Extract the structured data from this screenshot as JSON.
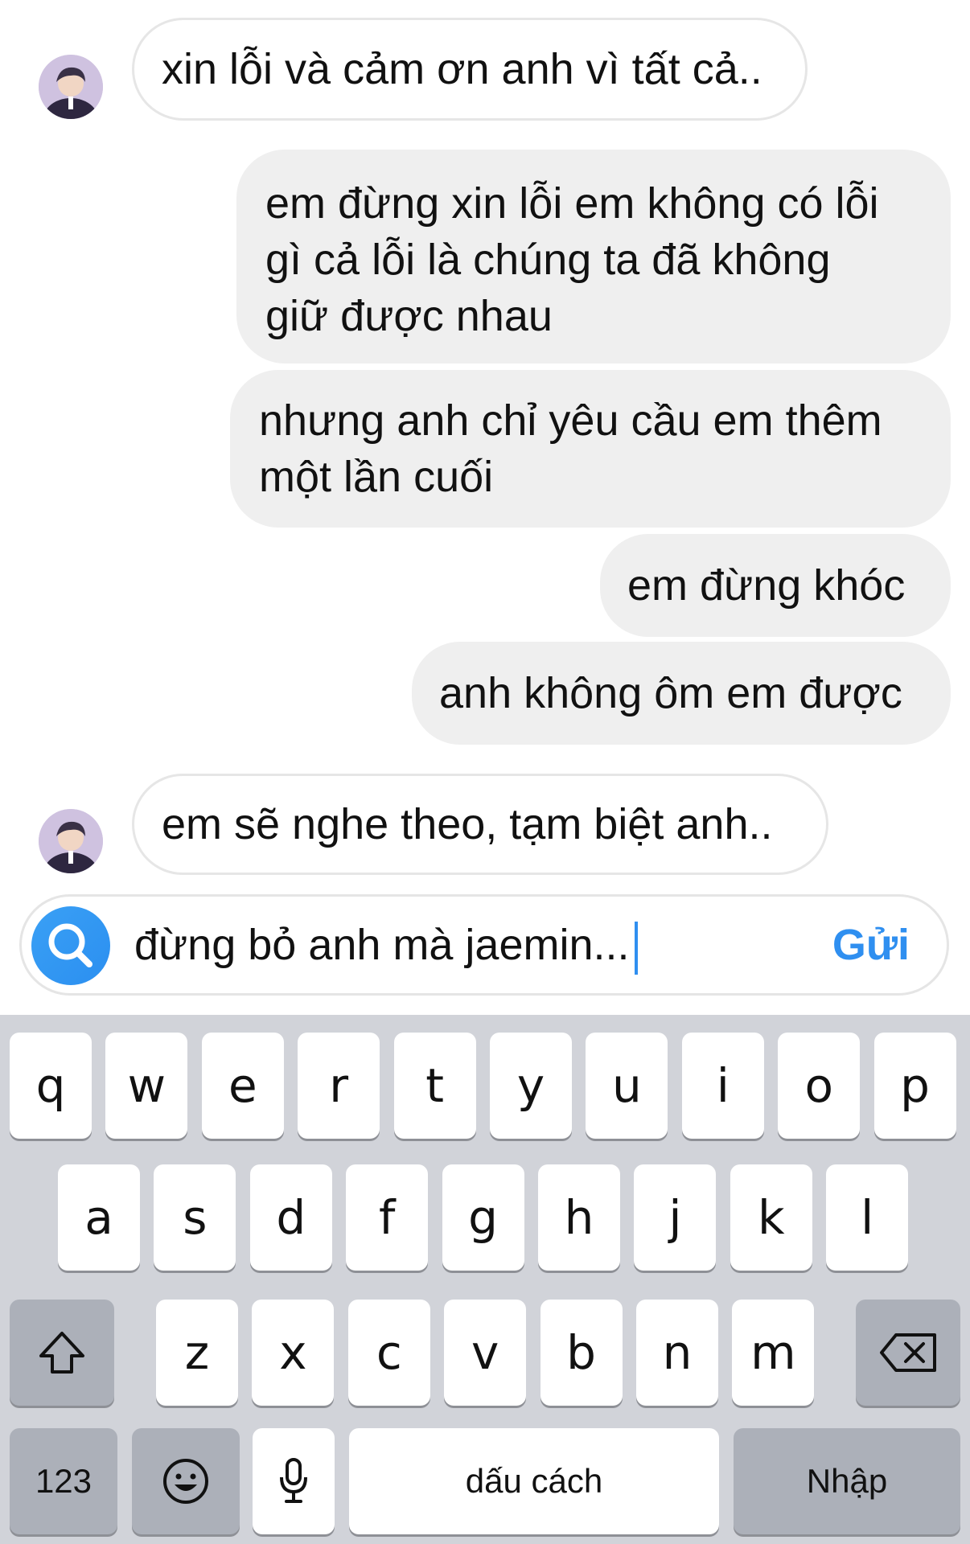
{
  "messages": [
    {
      "side": "in",
      "text": "xin lỗi và cảm ơn anh vì tất cả.."
    },
    {
      "side": "out",
      "lines": [
        "em đừng xin lỗi em không có lỗi",
        "gì cả lỗi là chúng ta đã không",
        "giữ được nhau"
      ]
    },
    {
      "side": "out",
      "lines": [
        "nhưng anh chỉ yêu cầu em thêm",
        "một lần cuối"
      ]
    },
    {
      "side": "out",
      "text": "em đừng khóc"
    },
    {
      "side": "out",
      "text": "anh không ôm em được"
    },
    {
      "side": "in",
      "text": "em sẽ nghe theo, tạm biệt anh.."
    }
  ],
  "composer": {
    "text": "đừng bỏ anh mà jaemin...",
    "send_label": "Gửi",
    "icon": "search-icon"
  },
  "keyboard": {
    "row1": [
      "q",
      "w",
      "e",
      "r",
      "t",
      "y",
      "u",
      "i",
      "o",
      "p"
    ],
    "row2": [
      "a",
      "s",
      "d",
      "f",
      "g",
      "h",
      "j",
      "k",
      "l"
    ],
    "row3": [
      "z",
      "x",
      "c",
      "v",
      "b",
      "n",
      "m"
    ],
    "numbers_label": "123",
    "space_label": "dấu cách",
    "return_label": "Nhập"
  },
  "colors": {
    "accent": "#2f8ff0",
    "outgoing_bubble": "#efefef",
    "keyboard_bg": "#d1d3d9",
    "key_dark": "#acb0b9"
  }
}
